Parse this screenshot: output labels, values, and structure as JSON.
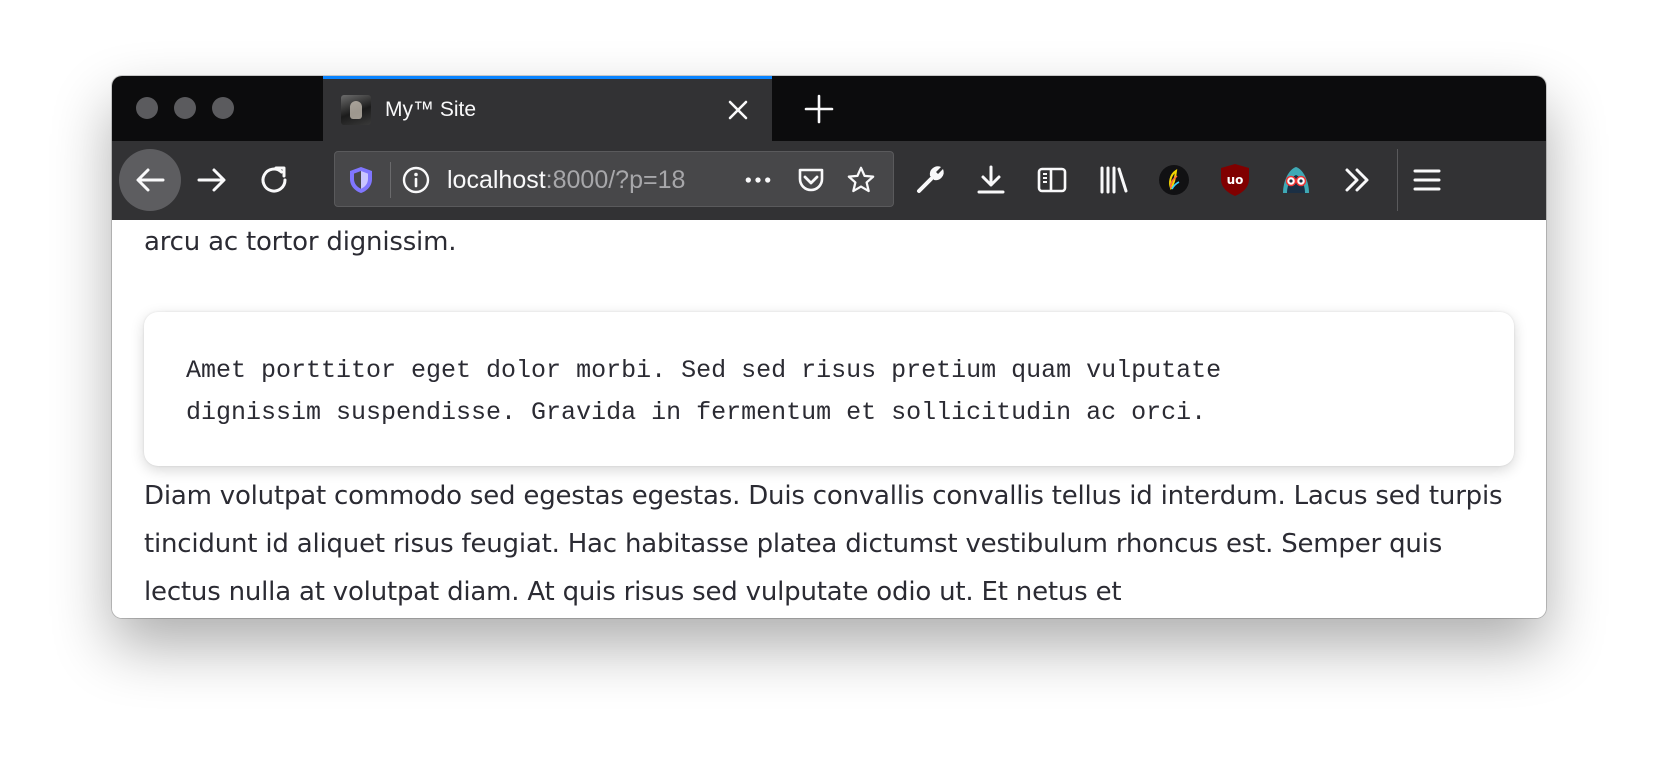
{
  "window": {
    "traffic_lights": [
      "close",
      "minimize",
      "zoom"
    ]
  },
  "tabs": [
    {
      "title": "My™ Site",
      "favicon": "portrait-favicon-icon",
      "active": true
    }
  ],
  "toolbar": {
    "navigation": [
      "back-arrow-icon",
      "forward-arrow-icon",
      "reload-icon"
    ],
    "url_host": "localhost",
    "url_rest": ":8000/?p=18",
    "url_icons": [
      "privacy-shield-icon",
      "info-icon",
      "page-actions-more-icon",
      "pocket-icon",
      "bookmark-star-icon"
    ],
    "extensions": [
      "developer-tools-wrench-icon",
      "downloads-icon",
      "sidebar-icon",
      "library-icon",
      "edge-extension-icon",
      "ublock-origin-icon",
      "privacy-badger-icon",
      "overflow-chevrons-icon",
      "hamburger-menu-icon"
    ]
  },
  "content": {
    "top_paragraph_tail": "arcu ac tortor dignissim.",
    "code_block": "Amet porttitor eget dolor morbi. Sed sed risus pretium quam vulputate\ndignissim suspendisse. Gravida in fermentum et sollicitudin ac orci.",
    "bottom_paragraph": "Diam volutpat commodo sed egestas egestas. Duis convallis convallis tellus id interdum. Lacus sed turpis tincidunt id aliquet risus feugiat. Hac habitasse platea dictumst vestibulum rhoncus est. Semper quis lectus nulla at volutpat diam. At quis risus sed vulputate odio ut. Et netus et"
  },
  "colors": {
    "accent": "#0a84ff",
    "tabstrip": "#0c0c0d",
    "toolbar": "#323234",
    "text": "#2b2b33",
    "ublock": "#800000"
  }
}
